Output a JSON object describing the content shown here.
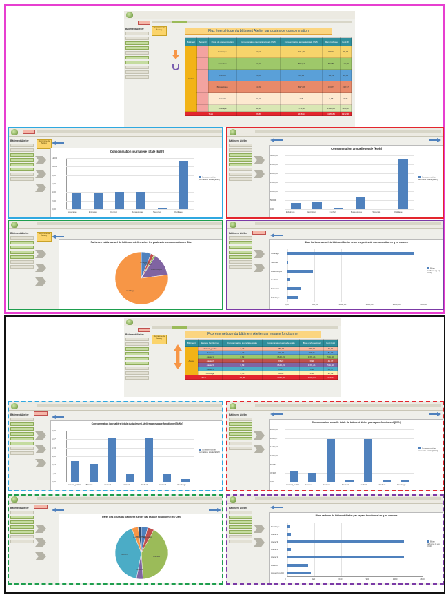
{
  "colors": {
    "frame_top": "#e73fd0",
    "frame_bottom": "#111111",
    "cyan": "#2fa8e0",
    "red": "#e3262e",
    "green": "#1e9e4e",
    "purple": "#7b3aa6",
    "bar": "#4f81bd",
    "banner": "#fbd580"
  },
  "group_top": {
    "banner_title": "Flux énergétique du bâtiment Atelier par postes de consommation",
    "table": {
      "headers": [
        "Bâtiment",
        "Appareil",
        "Poste de consommation",
        "Consommation journalière totale [kWh]",
        "Consommation annuelle totale [kWh]",
        "Bilan Carbone",
        "Coût [€]"
      ],
      "building": "Atelier",
      "rows": [
        {
          "poste": "Éclairage",
          "daily": "3,92",
          "annual": "941,35",
          "carbon": "785,34",
          "cost": "98,35"
        },
        {
          "poste": "Entretien",
          "daily": "3,89",
          "annual": "896,57",
          "carbon": "550,88",
          "cost": "118,35"
        },
        {
          "poste": "Confort",
          "daily": "4,00",
          "annual": "80,31",
          "carbon": "41,31",
          "cost": "10,65"
        },
        {
          "poste": "Bureautique",
          "daily": "4,09",
          "annual": "697,08",
          "carbon": "470,73",
          "cost": "228,57"
        },
        {
          "poste": "Sécurité",
          "daily": "0,10",
          "annual": "1,25",
          "carbon": "0,66",
          "cost": "0,49"
        },
        {
          "poste": "Outillage",
          "daily": "11,36",
          "annual": "2771,93",
          "carbon": "2339,06",
          "cost": "1110,97"
        }
      ],
      "total_label": "Total",
      "total": {
        "daily": "26,89",
        "annual": "5648,14",
        "carbon": "4189,86",
        "cost": "1272,49"
      }
    },
    "charts": {
      "daily_title": "Consommation journalière totale [kWh]",
      "annual_title": "Consommation annuelle totale [kWh]",
      "pie_title": "Parts des coûts annuel du bâtiment Atelier selon les postes de consommation en €/an",
      "carbon_title": "Bilan Carbone annuel du bâtiment Atelier selon les postes de consommation en g eq carbone",
      "legend_daily": "Consommation journalière totale [kWh]",
      "legend_annual": "Consommation annuelle totale [kWh]",
      "legend_carbon": "Bilan Carbone (g eq CO2)"
    }
  },
  "group_bottom": {
    "banner_title": "Flux énergétique du bâtiment Atelier par espace fonctionnel",
    "table": {
      "headers": [
        "Bâtiment",
        "Espace fonctionnel",
        "Consommation journalière totale",
        "Consommation annuelle totale",
        "Bilan carbone total",
        "Coût total"
      ],
      "building": "Atelier",
      "rows": [
        {
          "espace": "Accueil_public",
          "daily": "3,27",
          "annual": "386,74",
          "carbon": "281,27",
          "cost": "49,91"
        },
        {
          "espace": "Bureau",
          "daily": "2,77",
          "annual": "329,14",
          "carbon": "248,21",
          "cost": "54,17"
        },
        {
          "espace": "Atelier1",
          "daily": "6,89",
          "annual": "1643,49",
          "carbon": "1381,21",
          "cost": "511,80"
        },
        {
          "espace": "Atelier2",
          "daily": "1,31",
          "annual": "78,22",
          "carbon": "38,98",
          "cost": "48,77"
        },
        {
          "espace": "Atelier3",
          "daily": "6,89",
          "annual": "1643,49",
          "carbon": "1381,21",
          "cost": "511,80"
        },
        {
          "espace": "Atelier4",
          "daily": "1,31",
          "annual": "78,22",
          "carbon": "38,98",
          "cost": "48,77"
        },
        {
          "espace": "Stockage",
          "daily": "0,45",
          "annual": "50,96",
          "carbon": "32,18",
          "cost": "20,99"
        }
      ],
      "total_label": "Total",
      "total": {
        "daily": "22,89",
        "annual": "4230,26",
        "carbon": "3402,04",
        "cost": "1246,21"
      }
    },
    "charts": {
      "daily_title": "Consommation journalière totale du bâtiment Atelier par espace fonctionnel [kWh]",
      "annual_title": "Consommation annuelle totale du bâtiment Atelier par espace fonctionnel [kWh]",
      "pie_title": "Parts des coûts du bâtiment Atelier par espace fonctionnel en €/an",
      "carbon_title": "Bilan carbone du bâtiment Atelier par espace fonctionnel en g eq carbone",
      "legend_daily": "Consommation journalière totale [kWh]",
      "legend_annual": "Consommation annuelle totale [kWh]",
      "legend_carbon": "Bilan carbone (g eq CO2)"
    }
  },
  "ui": {
    "sidebar_title": "Bâtiment Atelier",
    "nav_button": "Flux énergie",
    "yellow_button": "Diagramme de Sankey",
    "toolbar_label": "Synthèse des flux"
  },
  "chart_data": [
    {
      "type": "bar",
      "title": "Consommation journalière totale [kWh]",
      "categories": [
        "Éclairage",
        "Entretien",
        "Confort",
        "Bureautique",
        "Sécurité",
        "Outillage"
      ],
      "series": [
        {
          "name": "Consommation journalière totale [kWh]",
          "values": [
            3.92,
            3.89,
            4.0,
            4.09,
            0.1,
            11.36
          ]
        }
      ],
      "ylim": [
        0,
        12
      ],
      "grid": true,
      "legend": "right"
    },
    {
      "type": "bar",
      "title": "Consommation annuelle totale [kWh]",
      "categories": [
        "Éclairage",
        "Entretien",
        "Confort",
        "Bureautique",
        "Sécurité",
        "Outillage"
      ],
      "series": [
        {
          "name": "Consommation annuelle totale [kWh]",
          "values": [
            341,
            397,
            80,
            697,
            1,
            2772
          ]
        }
      ],
      "ylim": [
        0,
        3000
      ],
      "yticks": [
        "0,00",
        "500,00",
        "1000,00",
        "1500,00",
        "2000,00",
        "2500,00",
        "3000,00"
      ],
      "grid": true,
      "legend": "right"
    },
    {
      "type": "pie",
      "title": "Parts des coûts annuel du bâtiment Atelier selon les postes de consommation en €/an",
      "categories": [
        "Éclairage",
        "Entretien",
        "Confort",
        "Bureautique",
        "Sécurité",
        "Outillage"
      ],
      "values": [
        6,
        2,
        1,
        14,
        0,
        77
      ],
      "colors": [
        "#4f81bd",
        "#c0504d",
        "#9bbb59",
        "#8064a2",
        "#4bacc6",
        "#f79646"
      ]
    },
    {
      "type": "bar",
      "orientation": "horizontal",
      "title": "Bilan Carbone annuel du bâtiment Atelier selon les postes de consommation en g eq carbone",
      "categories": [
        "Éclairage",
        "Entretien",
        "Confort",
        "Bureautique",
        "Sécurité",
        "Outillage"
      ],
      "series": [
        {
          "name": "Bilan Carbone (g eq CO2)",
          "values": [
            186,
            250,
            41,
            470,
            1,
            2339
          ]
        }
      ],
      "xlim": [
        0,
        2500
      ],
      "xticks": [
        "0,00",
        "500,00",
        "1000,00",
        "1500,00",
        "2000,00",
        "2500,00"
      ],
      "grid": true,
      "legend": "right"
    },
    {
      "type": "bar",
      "title": "Consommation journalière totale du bâtiment Atelier par espace fonctionnel [kWh]",
      "categories": [
        "Accueil_public",
        "Bureau",
        "Atelier1",
        "Atelier2",
        "Atelier3",
        "Atelier4",
        "Stockage"
      ],
      "series": [
        {
          "name": "Consommation journalière totale [kWh]",
          "values": [
            3.27,
            2.77,
            6.89,
            1.31,
            6.89,
            1.31,
            0.45
          ]
        }
      ],
      "ylim": [
        0,
        8
      ],
      "grid": true,
      "legend": "right"
    },
    {
      "type": "bar",
      "title": "Consommation annuelle totale du bâtiment Atelier par espace fonctionnel [kWh]",
      "categories": [
        "Accueil_public",
        "Bureau",
        "Atelier1",
        "Atelier2",
        "Atelier3",
        "Atelier4",
        "Stockage"
      ],
      "series": [
        {
          "name": "Consommation annuelle totale [kWh]",
          "values": [
            387,
            329,
            1643,
            78,
            1643,
            78,
            51
          ]
        }
      ],
      "ylim": [
        0,
        2000
      ],
      "grid": true,
      "legend": "right"
    },
    {
      "type": "pie",
      "title": "Parts des coûts du bâtiment Atelier par espace fonctionnel en €/an",
      "categories": [
        "Accueil_public",
        "Bureau",
        "Atelier1",
        "Atelier2",
        "Atelier3",
        "Atelier4",
        "Stockage"
      ],
      "values": [
        4,
        4,
        41,
        4,
        41,
        4,
        2
      ],
      "colors": [
        "#4f81bd",
        "#c0504d",
        "#9bbb59",
        "#8064a2",
        "#4bacc6",
        "#f79646",
        "#2c4d75"
      ]
    },
    {
      "type": "bar",
      "orientation": "horizontal",
      "title": "Bilan carbone du bâtiment Atelier par espace fonctionnel en g eq carbone",
      "categories": [
        "Accueil_public",
        "Bureau",
        "Atelier1",
        "Atelier2",
        "Atelier3",
        "Atelier4",
        "Stockage"
      ],
      "series": [
        {
          "name": "Bilan carbone (g eq CO2)",
          "values": [
            281,
            248,
            1381,
            39,
            1381,
            39,
            32
          ]
        }
      ],
      "xlim": [
        0,
        1600
      ],
      "grid": true,
      "legend": "right"
    }
  ]
}
